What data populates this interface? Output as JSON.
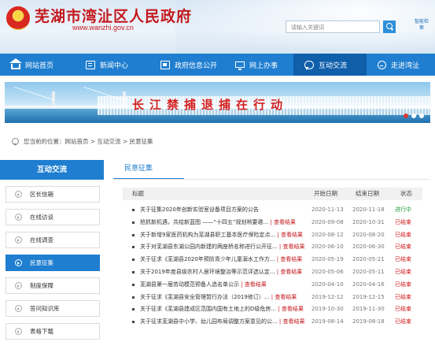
{
  "header": {
    "site_title": "芜湖市湾沚区人民政府",
    "site_url": "www.wanzhi.gov.cn",
    "search_placeholder": "请输入关键词",
    "smart_search": "智能检索"
  },
  "nav": {
    "items": [
      {
        "label": "网站首页",
        "icon": "home-icon"
      },
      {
        "label": "新闻中心",
        "icon": "newspaper-icon"
      },
      {
        "label": "政府信息公开",
        "icon": "document-icon"
      },
      {
        "label": "网上办事",
        "icon": "monitor-icon"
      },
      {
        "label": "互动交流",
        "icon": "chat-icon",
        "active": true
      },
      {
        "label": "走进湾沚",
        "icon": "walk-icon"
      }
    ]
  },
  "banner": {
    "text": "长江禁捕退捕在行动"
  },
  "breadcrumb": {
    "text": "您当前的位置：网站首页 > 互动交流 > 民意征集"
  },
  "sidebar": {
    "title": "互动交流",
    "items": [
      {
        "label": "区长信箱"
      },
      {
        "label": "在线访谈"
      },
      {
        "label": "在线调查"
      },
      {
        "label": "民意征集",
        "active": true
      },
      {
        "label": "制度保障"
      },
      {
        "label": "答问知识库"
      },
      {
        "label": "表格下载"
      }
    ]
  },
  "main": {
    "tab": "民意征集",
    "columns": {
      "title": "标题",
      "start": "开始日期",
      "end": "结束日期",
      "status": "状态"
    },
    "rows": [
      {
        "title": "关于征集2020年创新实验室设备项目方案的公告",
        "result": "",
        "start": "2020-11-13",
        "end": "2020-11-18",
        "status": "进行中"
      },
      {
        "title": "抢抓新机遇，共绘新蓝图 ——“十四五”规划哟要邀...",
        "result": "查看结果",
        "start": "2020-09-08",
        "end": "2020-10-31",
        "status": "已结束"
      },
      {
        "title": "关于新增9家医药机构为芜湖县职工基本医疗保险定点...",
        "result": "查看结果",
        "start": "2020-08-12",
        "end": "2020-08-20",
        "status": "已结束"
      },
      {
        "title": "关于对芜湖县东湖公园内新建的两座桥名称进行公开征...",
        "result": "查看结果",
        "start": "2020-06-10",
        "end": "2020-06-30",
        "status": "已结束"
      },
      {
        "title": "关于征求《芜湖县2020年预防青少年儿童溺水工作方...",
        "result": "查看结果",
        "start": "2020-05-19",
        "end": "2020-05-21",
        "status": "已结束"
      },
      {
        "title": "关于2019年度县级农村人居环境整治等示范评选认定...",
        "result": "查看结果",
        "start": "2020-05-06",
        "end": "2020-05-11",
        "status": "已结束"
      },
      {
        "title": "芜湖县第一届劳动模范预备人选名单公示",
        "result": "查看结果",
        "start": "2020-04-10",
        "end": "2020-04-16",
        "status": "已结束"
      },
      {
        "title": "关于征求《芜湖县安全管理暂行办法（2019修订）...",
        "result": "查看结果",
        "start": "2019-12-12",
        "end": "2019-12-15",
        "status": "已结束"
      },
      {
        "title": "关于征求《芜湖县建成区范围内国有土地上的D级危房...",
        "result": "查看结果",
        "start": "2019-10-30",
        "end": "2019-11-30",
        "status": "已结束"
      },
      {
        "title": "关于征求芜湖县中小学、幼儿园布局调整方案意见的公...",
        "result": "查看结果",
        "start": "2019-08-14",
        "end": "2019-08-18",
        "status": "已结束"
      }
    ]
  },
  "colors": {
    "brand_red": "#c3191d",
    "nav_blue": "#1f7ed0",
    "status_active": "#1d9a3a",
    "status_closed": "#d21b1b"
  }
}
